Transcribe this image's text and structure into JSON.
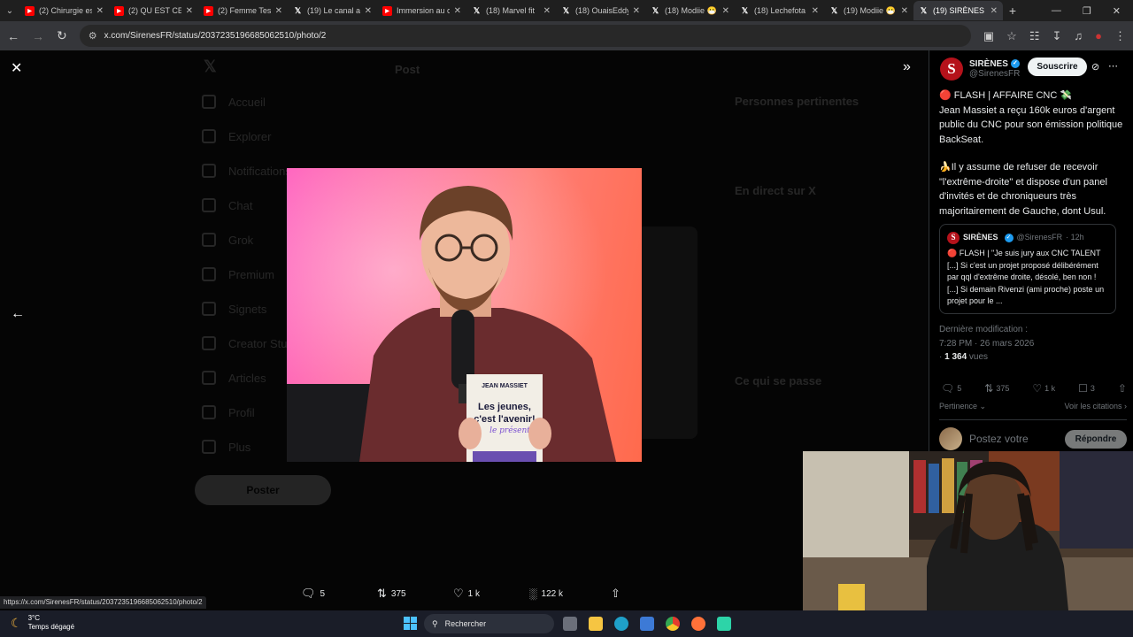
{
  "tabs": [
    {
      "title": "(2) Chirurgie esth",
      "type": "youtube"
    },
    {
      "title": "(2) QU EST CE",
      "type": "youtube"
    },
    {
      "title": "(2) Femme Test",
      "type": "youtube"
    },
    {
      "title": "(19) Le canal a",
      "type": "x"
    },
    {
      "title": "Immersion au c",
      "type": "youtube"
    },
    {
      "title": "(18) Marvel fit",
      "type": "x"
    },
    {
      "title": "(18) OuaisEddy",
      "type": "x"
    },
    {
      "title": "(18) Modiie 😷",
      "type": "x"
    },
    {
      "title": "(18) Lechefota",
      "type": "x"
    },
    {
      "title": "(19) Modiie 😷",
      "type": "x"
    },
    {
      "title": "(19) SIRÈNES s",
      "type": "x",
      "active": true
    }
  ],
  "address": {
    "url": "x.com/SirenesFR/status/2037235196685062510/photo/2"
  },
  "background": {
    "header": "Post",
    "nav": [
      "Accueil",
      "Explorer",
      "Notifications",
      "Chat",
      "Grok",
      "Premium",
      "Signets",
      "Creator Studio",
      "Articles",
      "Profil",
      "Plus"
    ],
    "post_button": "Poster",
    "relevant_title": "Personnes pertinentes",
    "trending_title": "En direct sur X",
    "happening_title": "Ce qui se passe"
  },
  "photo": {
    "book_author": "JEAN MASSIET",
    "book_title_line1": "Les jeunes,",
    "book_title_line2": "c'est l'avenir!",
    "book_annotation": "le présent"
  },
  "viewer_actions": {
    "replies": "5",
    "reposts": "375",
    "likes": "1 k",
    "views": "122 k"
  },
  "side": {
    "author_name": "SIRÈNES",
    "author_handle": "@SirenesFR",
    "subscribe": "Souscrire",
    "text": {
      "line1": "🔴 FLASH | AFFAIRE CNC 💸",
      "p1": "Jean Massiet a reçu 160k euros d'argent public du CNC pour son émission politique BackSeat.",
      "p2": "🍌Il y assume de refuser de recevoir \"l'extrême-droite\" et dispose d'un panel d'invités et de chroniqueurs très majoritairement de Gauche, dont Usul."
    },
    "quote": {
      "name": "SIRÈNES",
      "handle": "@SirenesFR",
      "time": "· 12h",
      "text": "🔴 FLASH | \"Je suis jury aux CNC TALENT [...] Si c'est un projet proposé délibérément par qql d'extrême droite, désolé, ben non ! [...] Si demain Rivenzi (ami proche) poste un projet pour le ..."
    },
    "modified_label": "Dernière modification :",
    "modified_time": "7:28 PM · 26 mars 2026",
    "views_num": "1 364",
    "views_label": "vues",
    "stats": {
      "replies": "5",
      "reposts": "375",
      "likes": "1 k",
      "bookmarks": "3"
    },
    "sort": "Pertinence",
    "see_quotes": "Voir les citations",
    "reply_placeholder": "Postez votre",
    "reply_button": "Répondre"
  },
  "status_url": "https://x.com/SirenesFR/status/2037235196685062510/photo/2",
  "taskbar": {
    "temp": "3°C",
    "weather": "Temps dégagé",
    "search": "Rechercher"
  }
}
